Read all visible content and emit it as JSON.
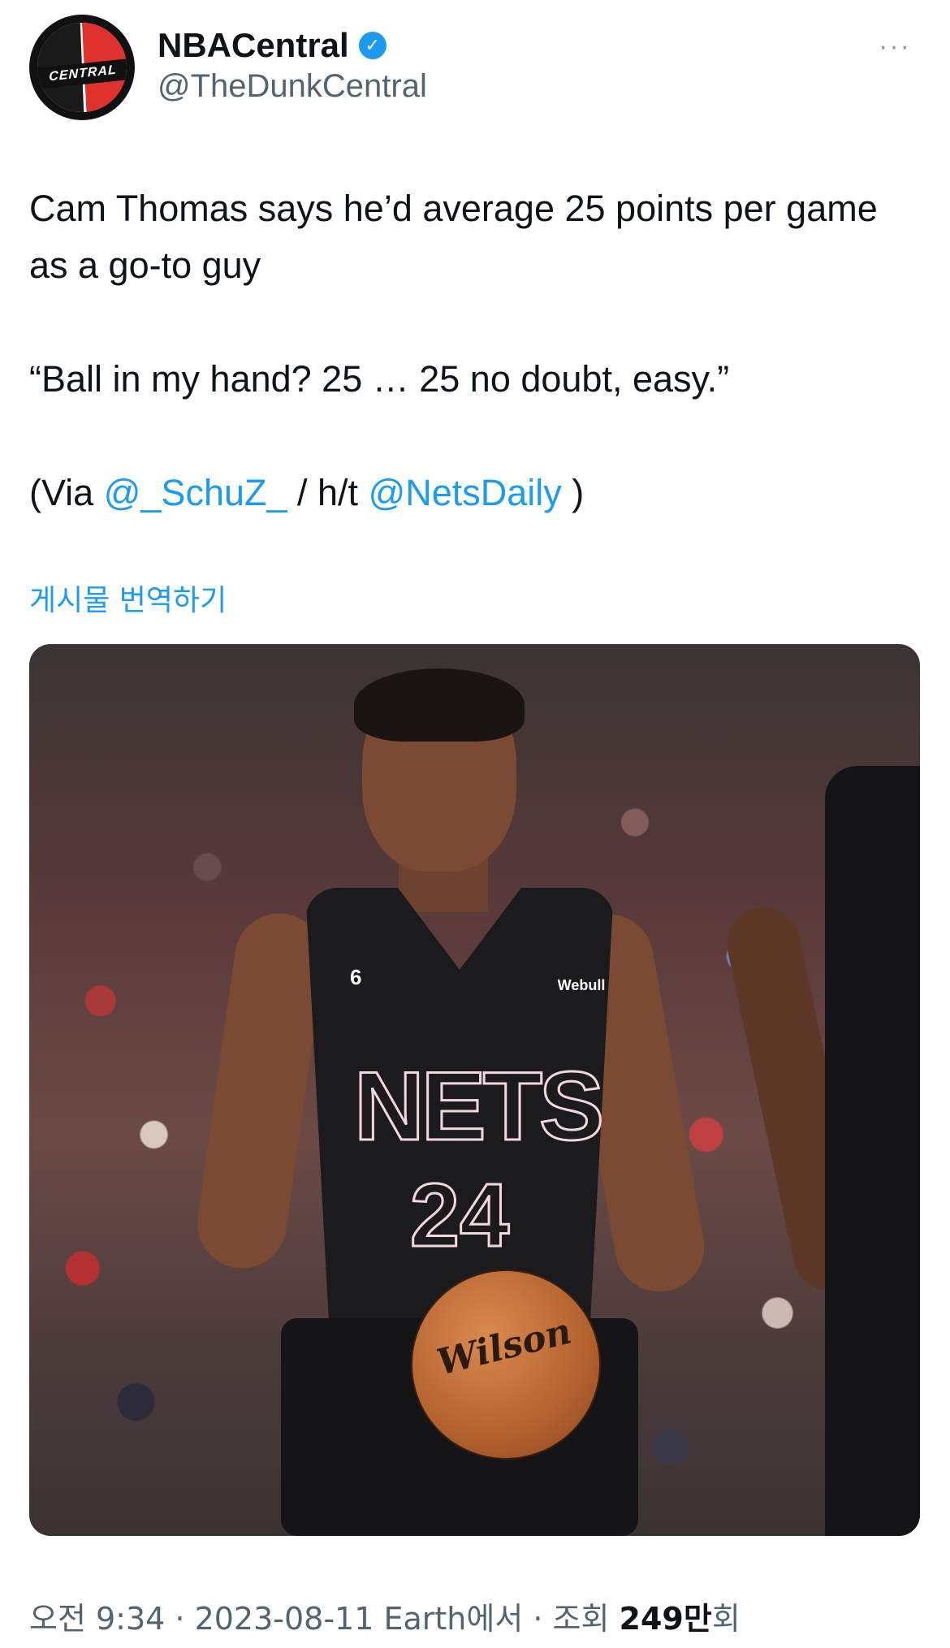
{
  "author": {
    "display_name": "NBACentral",
    "handle": "@TheDunkCentral",
    "avatar_text": "CENTRAL",
    "verified": true
  },
  "more_icon": "···",
  "tweet": {
    "line1": "Cam Thomas says he’d average 25 points per game as a go-to guy",
    "quote": "“Ball in my hand? 25 … 25 no doubt, easy.”",
    "via_prefix": "(Via ",
    "mention1": "@_SchuZ_",
    "via_middle": " / h/t ",
    "mention2": "@NetsDaily",
    "via_suffix": " )"
  },
  "translate_label": "게시물 번역하기",
  "photo": {
    "jersey_text": "NETS",
    "jersey_number": "24",
    "badge": "6",
    "sponsor": "Webull",
    "ball_brand": "Wilson"
  },
  "footer": {
    "meta": "오전 9:34 · 2023-08-11 Earth에서 · 조회 ",
    "views": "249만",
    "views_suffix": "회"
  },
  "colors": {
    "link": "#1d9bf0",
    "secondary_text": "#536471",
    "primary_text": "#0f1419"
  }
}
